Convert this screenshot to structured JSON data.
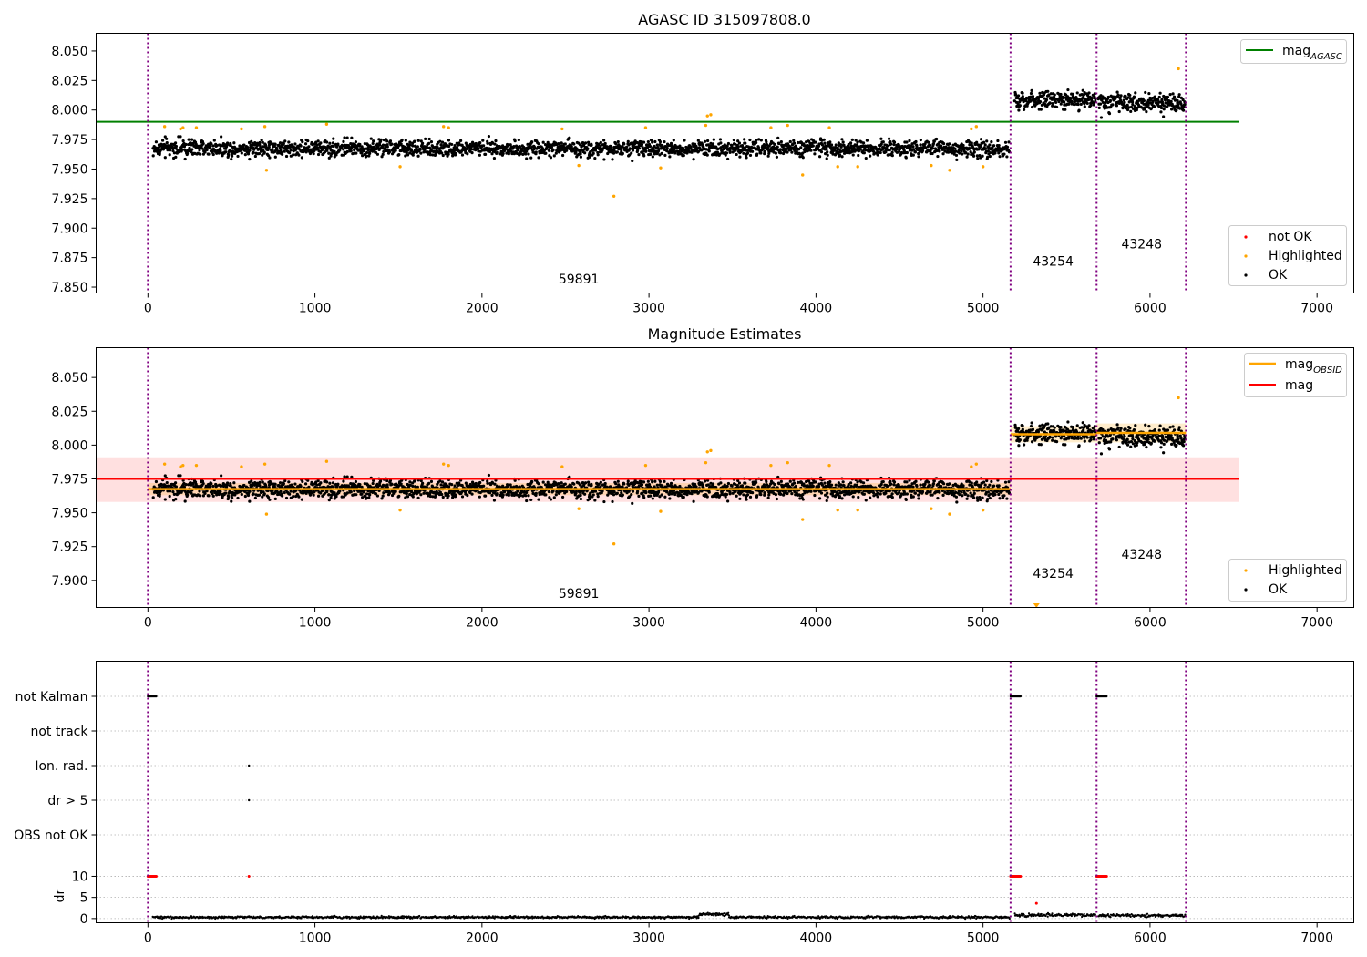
{
  "chart_data": [
    {
      "type": "scatter",
      "title": "AGASC ID 315097808.0",
      "xlim": [
        -310,
        7220
      ],
      "ylim": [
        7.845,
        8.065
      ],
      "xticks": [
        0,
        1000,
        2000,
        3000,
        4000,
        5000,
        6000,
        7000
      ],
      "yticks": [
        7.85,
        7.875,
        7.9,
        7.925,
        7.95,
        7.975,
        8.0,
        8.025,
        8.05
      ],
      "grid": false,
      "obsid_boundaries": [
        0,
        5165,
        5680,
        6215
      ],
      "obsid_labels": [
        {
          "text": "59891",
          "x": 2580,
          "y": 7.853
        },
        {
          "text": "43254",
          "x": 5420,
          "y": 7.868
        },
        {
          "text": "43248",
          "x": 5950,
          "y": 7.883
        }
      ],
      "reference_line": {
        "name": "mag_AGASC",
        "y": 7.99,
        "x": [
          -310,
          6535
        ],
        "color": "#008000"
      },
      "ok_segments": [
        {
          "x": [
            30,
            5160
          ],
          "center": 7.9675,
          "spread": 0.007
        },
        {
          "x": [
            5190,
            5675
          ],
          "center": 8.009,
          "spread": 0.007
        },
        {
          "x": [
            5690,
            6210
          ],
          "center": 8.006,
          "spread": 0.008
        }
      ],
      "highlighted_points": [
        {
          "x": 100,
          "y": 7.986
        },
        {
          "x": 195,
          "y": 7.984
        },
        {
          "x": 210,
          "y": 7.985
        },
        {
          "x": 290,
          "y": 7.985
        },
        {
          "x": 560,
          "y": 7.984
        },
        {
          "x": 700,
          "y": 7.986
        },
        {
          "x": 710,
          "y": 7.949
        },
        {
          "x": 1070,
          "y": 7.988
        },
        {
          "x": 1510,
          "y": 7.952
        },
        {
          "x": 1770,
          "y": 7.986
        },
        {
          "x": 1800,
          "y": 7.985
        },
        {
          "x": 2480,
          "y": 7.984
        },
        {
          "x": 2580,
          "y": 7.953
        },
        {
          "x": 2790,
          "y": 7.927
        },
        {
          "x": 2980,
          "y": 7.985
        },
        {
          "x": 3070,
          "y": 7.951
        },
        {
          "x": 3340,
          "y": 7.987
        },
        {
          "x": 3350,
          "y": 7.995
        },
        {
          "x": 3370,
          "y": 7.996
        },
        {
          "x": 3730,
          "y": 7.985
        },
        {
          "x": 3830,
          "y": 7.987
        },
        {
          "x": 3920,
          "y": 7.945
        },
        {
          "x": 4080,
          "y": 7.985
        },
        {
          "x": 4130,
          "y": 7.952
        },
        {
          "x": 4250,
          "y": 7.952
        },
        {
          "x": 4690,
          "y": 7.953
        },
        {
          "x": 4800,
          "y": 7.949
        },
        {
          "x": 4930,
          "y": 7.984
        },
        {
          "x": 4960,
          "y": 7.986
        },
        {
          "x": 5000,
          "y": 7.952
        },
        {
          "x": 6170,
          "y": 8.035
        }
      ],
      "legends": [
        {
          "position": "upper right",
          "entries": [
            {
              "label": "mag",
              "sub": "AGASC",
              "marker": "line",
              "color": "#008000"
            }
          ]
        },
        {
          "position": "lower right",
          "entries": [
            {
              "label": "not OK",
              "marker": "dot",
              "color": "#ff0000"
            },
            {
              "label": "Highlighted",
              "marker": "dot",
              "color": "#ffa500"
            },
            {
              "label": "OK",
              "marker": "dot",
              "color": "#000000"
            }
          ]
        }
      ]
    },
    {
      "type": "scatter",
      "title": "Magnitude Estimates",
      "xlim": [
        -310,
        7220
      ],
      "ylim": [
        7.88,
        8.072
      ],
      "xticks": [
        0,
        1000,
        2000,
        3000,
        4000,
        5000,
        6000,
        7000
      ],
      "yticks": [
        7.9,
        7.925,
        7.95,
        7.975,
        8.0,
        8.025,
        8.05
      ],
      "grid": false,
      "obsid_boundaries": [
        0,
        5165,
        5680,
        6215
      ],
      "obsid_labels": [
        {
          "text": "59891",
          "x": 2580,
          "y": 7.887
        },
        {
          "text": "43254",
          "x": 5420,
          "y": 7.902
        },
        {
          "text": "43248",
          "x": 5950,
          "y": 7.916
        }
      ],
      "mag_band": {
        "x": [
          -310,
          6535
        ],
        "y": [
          7.958,
          7.991
        ],
        "color": "#ff0000",
        "opacity": 0.12
      },
      "mag_line": {
        "name": "mag",
        "y": 7.975,
        "x": [
          -310,
          6535
        ],
        "color": "#ff0000"
      },
      "mag_obsid_segments": [
        {
          "x": [
            0,
            5165
          ],
          "y": 7.9675,
          "band": [
            7.963,
            7.972
          ]
        },
        {
          "x": [
            5165,
            5680
          ],
          "y": 8.008,
          "band": [
            8.002,
            8.014
          ]
        },
        {
          "x": [
            5680,
            6215
          ],
          "y": 8.009,
          "band": [
            8.002,
            8.016
          ]
        }
      ],
      "ok_segments": [
        {
          "x": [
            30,
            5160
          ],
          "center": 7.9675,
          "spread": 0.007
        },
        {
          "x": [
            5190,
            5675
          ],
          "center": 8.009,
          "spread": 0.007
        },
        {
          "x": [
            5690,
            6210
          ],
          "center": 8.006,
          "spread": 0.008
        }
      ],
      "highlighted_points": [
        {
          "x": 100,
          "y": 7.986
        },
        {
          "x": 195,
          "y": 7.984
        },
        {
          "x": 210,
          "y": 7.985
        },
        {
          "x": 290,
          "y": 7.985
        },
        {
          "x": 560,
          "y": 7.984
        },
        {
          "x": 700,
          "y": 7.986
        },
        {
          "x": 710,
          "y": 7.949
        },
        {
          "x": 1070,
          "y": 7.988
        },
        {
          "x": 1510,
          "y": 7.952
        },
        {
          "x": 1770,
          "y": 7.986
        },
        {
          "x": 1800,
          "y": 7.985
        },
        {
          "x": 2480,
          "y": 7.984
        },
        {
          "x": 2580,
          "y": 7.953
        },
        {
          "x": 2790,
          "y": 7.927
        },
        {
          "x": 2980,
          "y": 7.985
        },
        {
          "x": 3070,
          "y": 7.951
        },
        {
          "x": 3340,
          "y": 7.987
        },
        {
          "x": 3350,
          "y": 7.995
        },
        {
          "x": 3370,
          "y": 7.996
        },
        {
          "x": 3730,
          "y": 7.985
        },
        {
          "x": 3830,
          "y": 7.987
        },
        {
          "x": 3920,
          "y": 7.945
        },
        {
          "x": 4080,
          "y": 7.985
        },
        {
          "x": 4130,
          "y": 7.952
        },
        {
          "x": 4250,
          "y": 7.952
        },
        {
          "x": 4690,
          "y": 7.953
        },
        {
          "x": 4800,
          "y": 7.949
        },
        {
          "x": 4930,
          "y": 7.984
        },
        {
          "x": 4960,
          "y": 7.986
        },
        {
          "x": 5000,
          "y": 7.952
        },
        {
          "x": 6170,
          "y": 8.035
        }
      ],
      "offscale_marker": {
        "x": 5320,
        "y": 7.881,
        "color": "#ffa500"
      },
      "legends": [
        {
          "position": "upper right",
          "entries": [
            {
              "label": "mag",
              "sub": "OBSID",
              "marker": "line",
              "color": "#ffa500"
            },
            {
              "label": "mag",
              "marker": "line",
              "color": "#ff0000"
            }
          ]
        },
        {
          "position": "lower right",
          "entries": [
            {
              "label": "Highlighted",
              "marker": "dot",
              "color": "#ffa500"
            },
            {
              "label": "OK",
              "marker": "dot",
              "color": "#000000"
            }
          ]
        }
      ]
    },
    {
      "type": "scatter",
      "title": "",
      "xlim": [
        -310,
        7220
      ],
      "categories": [
        "not Kalman",
        "not track",
        "Ion. rad.",
        "dr > 5",
        "OBS not OK"
      ],
      "obsid_boundaries": [
        0,
        5165,
        5680,
        6215
      ],
      "flag_points": [
        {
          "category": "not Kalman",
          "x": [
            0,
            50
          ]
        },
        {
          "category": "not Kalman",
          "x": [
            5165,
            5225
          ]
        },
        {
          "category": "not Kalman",
          "x": [
            5680,
            5740
          ]
        },
        {
          "category": "Ion. rad.",
          "x": [
            605,
            605
          ]
        },
        {
          "category": "dr > 5",
          "x": [
            605,
            605
          ]
        }
      ]
    },
    {
      "type": "scatter",
      "title": "",
      "ylabel": "dr",
      "xlim": [
        -310,
        7220
      ],
      "ylim": [
        -1,
        11.5
      ],
      "xticks": [
        0,
        1000,
        2000,
        3000,
        4000,
        5000,
        6000,
        7000
      ],
      "yticks": [
        0,
        5,
        10
      ],
      "obsid_boundaries": [
        0,
        5165,
        5680,
        6215
      ],
      "ok_segments": [
        {
          "x": [
            30,
            3300
          ],
          "center": 0.3,
          "spread": 0.25
        },
        {
          "x": [
            3300,
            3480
          ],
          "center": 1.0,
          "spread": 0.4
        },
        {
          "x": [
            3480,
            5160
          ],
          "center": 0.3,
          "spread": 0.25
        },
        {
          "x": [
            5190,
            5675
          ],
          "center": 0.8,
          "spread": 0.4
        },
        {
          "x": [
            5690,
            6210
          ],
          "center": 0.7,
          "spread": 0.35
        }
      ],
      "not_ok_points": [
        {
          "x": [
            0,
            50
          ],
          "y": 10
        },
        {
          "x": [
            605,
            605
          ],
          "y": 10
        },
        {
          "x": [
            5165,
            5225
          ],
          "y": 10
        },
        {
          "x": [
            5320,
            5320
          ],
          "y": 3.6
        },
        {
          "x": [
            5680,
            5740
          ],
          "y": 10
        }
      ]
    }
  ]
}
